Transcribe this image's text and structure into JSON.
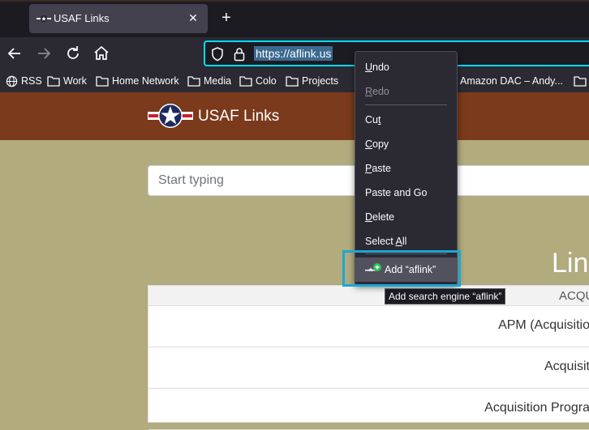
{
  "browser": {
    "tab": {
      "title": "USAF Links",
      "close": "✕"
    },
    "new_tab": "+",
    "url": "https://aflink.us",
    "bookmarks": [
      {
        "label": "RSS",
        "icon": "globe-icon"
      },
      {
        "label": "Work",
        "icon": "folder-icon"
      },
      {
        "label": "Home Network",
        "icon": "folder-icon"
      },
      {
        "label": "Media",
        "icon": "folder-icon"
      },
      {
        "label": "Colo",
        "icon": "folder-icon"
      },
      {
        "label": "Projects",
        "icon": "folder-icon"
      },
      {
        "label": "Amazon DAC – Andy...",
        "icon": "bookmark-icon"
      },
      {
        "label": "",
        "icon": "folder-icon"
      }
    ]
  },
  "site": {
    "title": "USAF Links",
    "search_placeholder": "Start typing",
    "heading": "Link",
    "table_header": "ACQU",
    "rows": [
      "APM (Acquisitio",
      "Acquisit",
      "Acquisition Progra"
    ]
  },
  "context_menu": {
    "undo": {
      "pre": "",
      "key": "U",
      "post": "ndo"
    },
    "redo": {
      "pre": "",
      "key": "R",
      "post": "edo"
    },
    "cut": {
      "pre": "Cu",
      "key": "t",
      "post": ""
    },
    "copy": {
      "pre": "",
      "key": "C",
      "post": "opy"
    },
    "paste": {
      "pre": "",
      "key": "P",
      "post": "aste"
    },
    "paste_go": "Paste and Go",
    "delete": {
      "pre": "",
      "key": "D",
      "post": "elete"
    },
    "select_all": {
      "pre": "Select ",
      "key": "A",
      "post": "ll"
    },
    "add_engine": "Add “aflink”"
  },
  "tooltip": "Add search engine “aflink”",
  "colors": {
    "accent": "#00ddff",
    "header": "#7a3a1b",
    "page_bg": "#b1ab7e",
    "highlight": "#1aa7d6"
  }
}
